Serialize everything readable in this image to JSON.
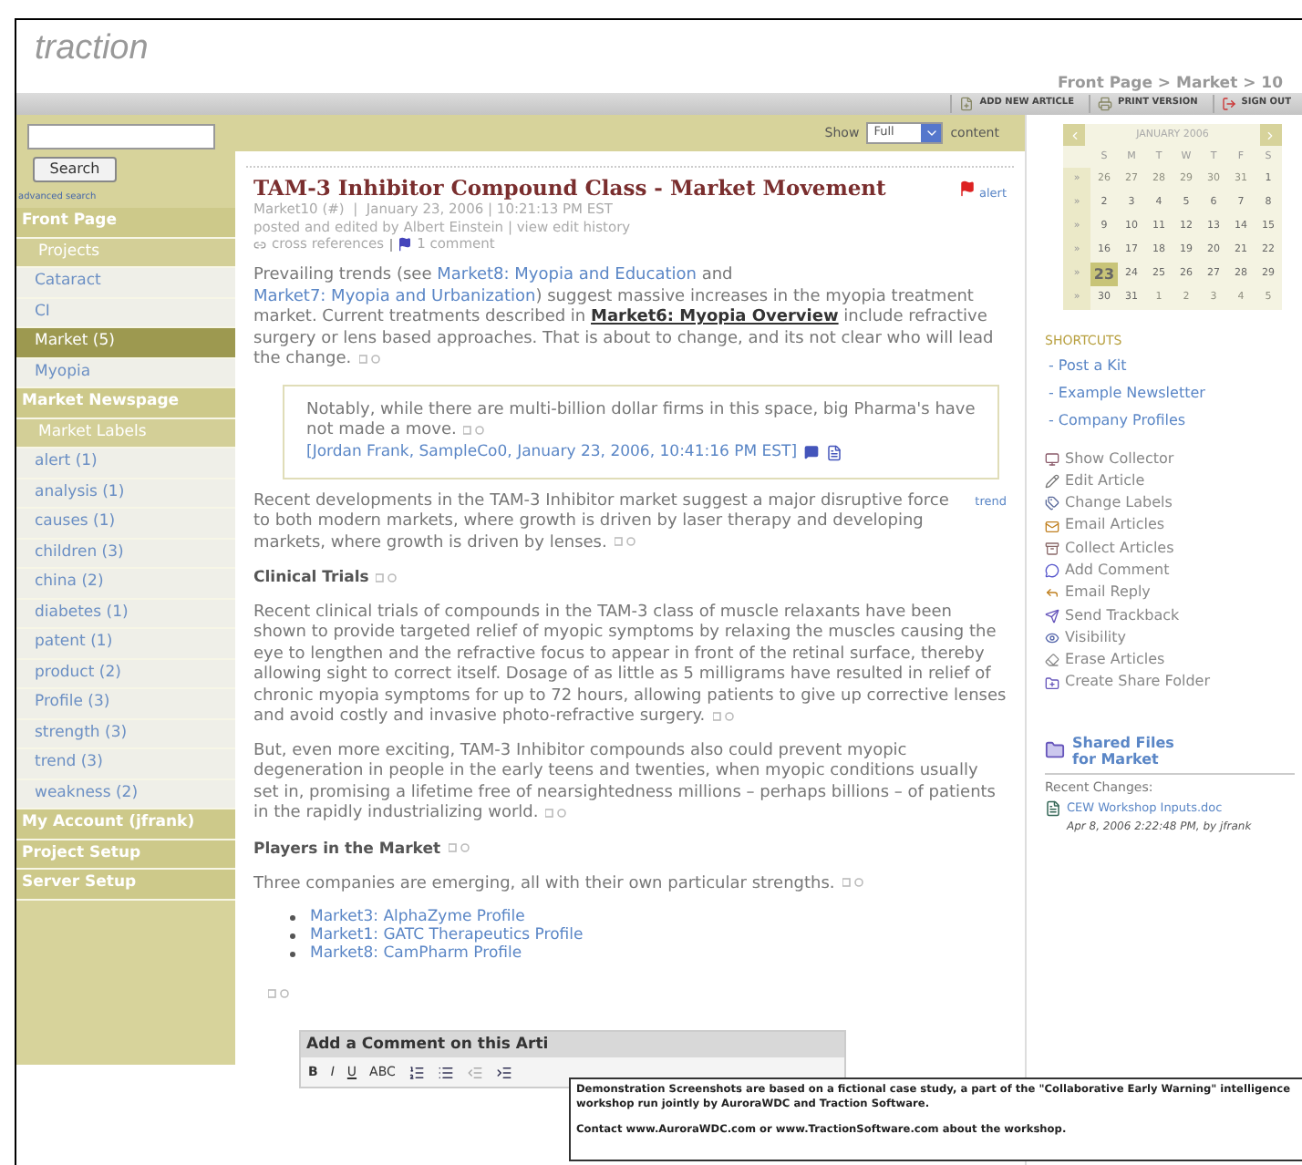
{
  "logo": "traction",
  "breadcrumb": "Front Page > Market > 10",
  "toolbar": [
    {
      "label": "ADD NEW ARTICLE"
    },
    {
      "label": "PRINT VERSION"
    },
    {
      "label": "SIGN OUT"
    }
  ],
  "search": {
    "button": "Search",
    "advanced": "advanced search"
  },
  "nav": [
    {
      "kind": "section",
      "label": "Front Page",
      "selected": false
    },
    {
      "kind": "header",
      "label": "Projects",
      "selected": false
    },
    {
      "kind": "item",
      "label": "Cataract",
      "selected": false
    },
    {
      "kind": "item",
      "label": "CI",
      "selected": false
    },
    {
      "kind": "item",
      "label": "Market (5)",
      "selected": true
    },
    {
      "kind": "item",
      "label": "Myopia",
      "selected": false
    },
    {
      "kind": "section",
      "label": "Market Newspage",
      "selected": false
    },
    {
      "kind": "header",
      "label": "Market Labels",
      "selected": false
    },
    {
      "kind": "item",
      "label": "alert (1)",
      "selected": false
    },
    {
      "kind": "item",
      "label": "analysis (1)",
      "selected": false
    },
    {
      "kind": "item",
      "label": "causes (1)",
      "selected": false
    },
    {
      "kind": "item",
      "label": "children (3)",
      "selected": false
    },
    {
      "kind": "item",
      "label": "china (2)",
      "selected": false
    },
    {
      "kind": "item",
      "label": "diabetes (1)",
      "selected": false
    },
    {
      "kind": "item",
      "label": "patent (1)",
      "selected": false
    },
    {
      "kind": "item",
      "label": "product (2)",
      "selected": false
    },
    {
      "kind": "item",
      "label": "Profile (3)",
      "selected": false
    },
    {
      "kind": "item",
      "label": "strength (3)",
      "selected": false
    },
    {
      "kind": "item",
      "label": "trend (3)",
      "selected": false
    },
    {
      "kind": "item",
      "label": "weakness (2)",
      "selected": false
    },
    {
      "kind": "section",
      "label": "My Account (jfrank)",
      "selected": false
    },
    {
      "kind": "section",
      "label": "Project Setup",
      "selected": false
    },
    {
      "kind": "section",
      "label": "Server Setup",
      "selected": false
    }
  ],
  "show": {
    "label": "Show",
    "value": "Full",
    "suffix": "content"
  },
  "article": {
    "title": "TAM-3 Inhibitor Compound Class - Market Movement",
    "alert": "alert",
    "meta": [
      "Market10 (#)  |  January 23, 2006 | 10:21:13 PM EST",
      "posted and edited by Albert Einstein | view edit history"
    ],
    "cross_references": "cross references",
    "comments": "1 comment",
    "blocks": [
      {
        "kind": "paragraph",
        "segments": [
          {
            "kind": "text",
            "text": "Prevailing trends (see "
          },
          {
            "kind": "link",
            "text": "Market8: Myopia and Education"
          },
          {
            "kind": "text",
            "text": " and "
          },
          {
            "kind": "link",
            "text": "Market7: Myopia and Urbanization"
          },
          {
            "kind": "text",
            "text": ") suggest massive increases in the myopia treatment market. Current treatments described in "
          },
          {
            "kind": "strong-link",
            "text": "Market6: Myopia Overview"
          },
          {
            "kind": "text",
            "text": " include refractive surgery or lens based approaches. That is about to change, and its not clear who will lead the change."
          }
        ]
      },
      {
        "kind": "quote",
        "text": "Notably, while there are multi-billion dollar firms in this space, big Pharma's have not made a move.",
        "attribution": "[Jordan Frank, SampleCo0, January 23, 2006, 10:41:16 PM EST]"
      },
      {
        "kind": "paragraph",
        "tag": "trend",
        "segments": [
          {
            "kind": "text",
            "text": "Recent developments in the TAM-3 Inhibitor market suggest a major disruptive force to both modern markets, where growth is driven by laser therapy and developing markets, where growth is driven by lenses."
          }
        ]
      },
      {
        "kind": "heading",
        "text": "Clinical Trials"
      },
      {
        "kind": "paragraph",
        "segments": [
          {
            "kind": "text",
            "text": "Recent clinical trials of compounds in the TAM-3 class of muscle relaxants have been shown to provide targeted relief of myopic symptoms by relaxing the muscles causing the eye to lengthen and the refractive focus to appear in front of the retinal surface, thereby allowing sight to correct itself. Dosage of as little as 5 milligrams have resulted in relief of chronic myopia symptoms for up to 72 hours, allowing patients to give up corrective lenses and avoid costly and invasive photo-refractive surgery."
          }
        ]
      },
      {
        "kind": "paragraph",
        "segments": [
          {
            "kind": "text",
            "text": "But, even more exciting, TAM-3 Inhibitor compounds also could prevent myopic degeneration in people in the early teens and twenties, when myopic conditions usually set in, promising a lifetime free of nearsightedness millions – perhaps billions – of patients in the rapidly industrializing world."
          }
        ]
      },
      {
        "kind": "heading",
        "text": "Players in the Market"
      },
      {
        "kind": "paragraph",
        "segments": [
          {
            "kind": "text",
            "text": "Three companies are emerging, all with their own particular strengths."
          }
        ]
      },
      {
        "kind": "list",
        "items": [
          "Market3: AlphaZyme Profile",
          "Market1: GATC Therapeutics Profile",
          "Market8: CamPharm Profile"
        ]
      }
    ]
  },
  "comment_box": {
    "title": "Add a Comment on this Arti",
    "buttons": [
      "B",
      "I",
      "U",
      "ABC"
    ]
  },
  "notice": [
    "Demonstration Screenshots are based on a fictional case study, a part of the \"Collaborative Early Warning\" intelligence workshop run jointly by AuroraWDC and Traction Software.",
    "Contact www.AuroraWDC.com or www.TractionSoftware.com about the workshop."
  ],
  "calendar": {
    "month": "JANUARY 2006",
    "weekdays": [
      "S",
      "M",
      "T",
      "W",
      "T",
      "F",
      "S"
    ],
    "weeks": [
      {
        "marker": "»",
        "days": [
          {
            "day": "26",
            "muted": true,
            "selected": false
          },
          {
            "day": "27",
            "muted": true,
            "selected": false
          },
          {
            "day": "28",
            "muted": true,
            "selected": false
          },
          {
            "day": "29",
            "muted": true,
            "selected": false
          },
          {
            "day": "30",
            "muted": true,
            "selected": false
          },
          {
            "day": "31",
            "muted": true,
            "selected": false
          },
          {
            "day": "1",
            "muted": false,
            "selected": false
          }
        ]
      },
      {
        "marker": "»",
        "days": [
          {
            "day": "2",
            "muted": false,
            "selected": false
          },
          {
            "day": "3",
            "muted": false,
            "selected": false
          },
          {
            "day": "4",
            "muted": false,
            "selected": false
          },
          {
            "day": "5",
            "muted": false,
            "selected": false
          },
          {
            "day": "6",
            "muted": false,
            "selected": false
          },
          {
            "day": "7",
            "muted": false,
            "selected": false
          },
          {
            "day": "8",
            "muted": false,
            "selected": false
          }
        ]
      },
      {
        "marker": "»",
        "days": [
          {
            "day": "9",
            "muted": false,
            "selected": false
          },
          {
            "day": "10",
            "muted": false,
            "selected": false
          },
          {
            "day": "11",
            "muted": false,
            "selected": false
          },
          {
            "day": "12",
            "muted": false,
            "selected": false
          },
          {
            "day": "13",
            "muted": false,
            "selected": false
          },
          {
            "day": "14",
            "muted": false,
            "selected": false
          },
          {
            "day": "15",
            "muted": false,
            "selected": false
          }
        ]
      },
      {
        "marker": "»",
        "days": [
          {
            "day": "16",
            "muted": false,
            "selected": false
          },
          {
            "day": "17",
            "muted": false,
            "selected": false
          },
          {
            "day": "18",
            "muted": false,
            "selected": false
          },
          {
            "day": "19",
            "muted": false,
            "selected": false
          },
          {
            "day": "20",
            "muted": false,
            "selected": false
          },
          {
            "day": "21",
            "muted": false,
            "selected": false
          },
          {
            "day": "22",
            "muted": false,
            "selected": false
          }
        ]
      },
      {
        "marker": "»",
        "days": [
          {
            "day": "23",
            "muted": false,
            "selected": true
          },
          {
            "day": "24",
            "muted": false,
            "selected": false
          },
          {
            "day": "25",
            "muted": false,
            "selected": false
          },
          {
            "day": "26",
            "muted": false,
            "selected": false
          },
          {
            "day": "27",
            "muted": false,
            "selected": false
          },
          {
            "day": "28",
            "muted": false,
            "selected": false
          },
          {
            "day": "29",
            "muted": false,
            "selected": false
          }
        ]
      },
      {
        "marker": "»",
        "days": [
          {
            "day": "30",
            "muted": false,
            "selected": false
          },
          {
            "day": "31",
            "muted": false,
            "selected": false
          },
          {
            "day": "1",
            "muted": true,
            "selected": false
          },
          {
            "day": "2",
            "muted": true,
            "selected": false
          },
          {
            "day": "3",
            "muted": true,
            "selected": false
          },
          {
            "day": "4",
            "muted": true,
            "selected": false
          },
          {
            "day": "5",
            "muted": true,
            "selected": false
          }
        ]
      }
    ]
  },
  "shortcuts": {
    "title": "SHORTCUTS",
    "items": [
      "- Post a Kit",
      "- Example Newsletter",
      "- Company Profiles"
    ]
  },
  "actions": [
    "Show Collector",
    "Edit Article",
    "Change Labels",
    "Email Articles",
    "Collect Articles",
    "Add Comment",
    "Email Reply",
    "Send Trackback",
    "Visibility",
    "Erase Articles",
    "Create Share Folder"
  ],
  "shared_files": "Shared Files for Market",
  "recent": {
    "title": "Recent Changes:",
    "file": "CEW Workshop Inputs.doc",
    "info": "Apr 8, 2006 2:22:48 PM, by jfrank"
  }
}
